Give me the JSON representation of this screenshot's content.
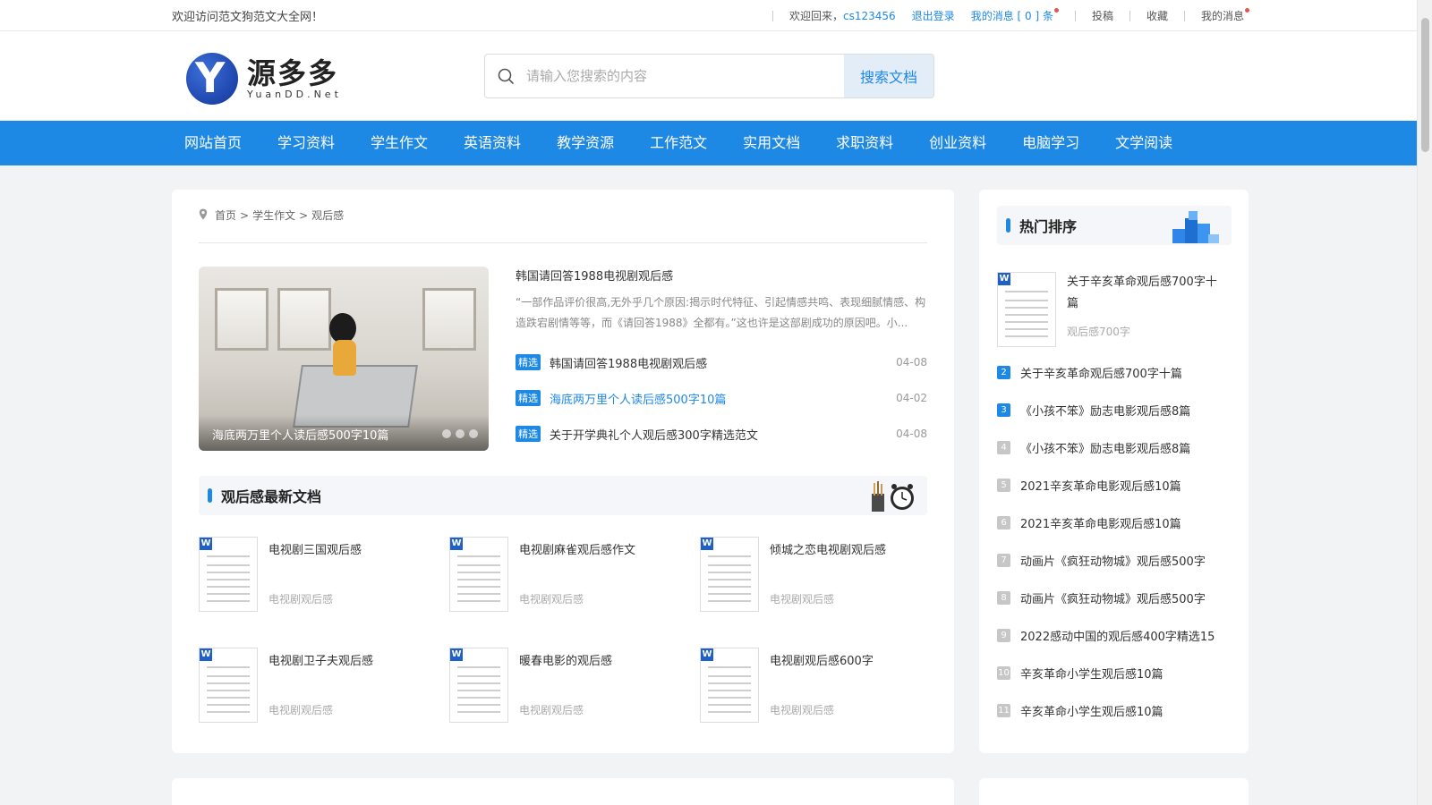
{
  "topbar": {
    "welcome_site": "欢迎访问范文狗范文大全网！",
    "welcome_back": "欢迎回来，",
    "username": "cs123456",
    "logout": "退出登录",
    "my_messages": "我的消息 [ 0 ] 条",
    "submit": "投稿",
    "favorites": "收藏",
    "my_messages_short": "我的消息"
  },
  "logo": {
    "cn": "源多多",
    "en": "YuanDD.Net"
  },
  "search": {
    "placeholder": "请输入您搜索的内容",
    "button": "搜索文档"
  },
  "nav": [
    "网站首页",
    "学习资料",
    "学生作文",
    "英语资料",
    "教学资源",
    "工作范文",
    "实用文档",
    "求职资料",
    "创业资料",
    "电脑学习",
    "文学阅读"
  ],
  "breadcrumb": {
    "home": "首页",
    "level1": "学生作文",
    "level2": "观后感",
    "sep": ">"
  },
  "banner": {
    "caption": "海底两万里个人读后感500字10篇"
  },
  "feature": {
    "title": "韩国请回答1988电视剧观后感",
    "desc": "“一部作品评价很高,无外乎几个原因:揭示时代特征、引起情感共鸣、表现细腻情感、构造跌宕剧情等等，而《请回答1988》全都有。”这也许是这部剧成功的原因吧。小...",
    "items": [
      {
        "tag": "精选",
        "title": "韩国请回答1988电视剧观后感",
        "date": "04-08"
      },
      {
        "tag": "精选",
        "title": "海底两万里个人读后感500字10篇",
        "date": "04-02"
      },
      {
        "tag": "精选",
        "title": "关于开学典礼个人观后感300字精选范文",
        "date": "04-08"
      }
    ]
  },
  "latest": {
    "title": "观后感最新文档",
    "docs": [
      {
        "title": "电视剧三国观后感",
        "sub": "电视剧观后感"
      },
      {
        "title": "电视剧麻雀观后感作文",
        "sub": "电视剧观后感"
      },
      {
        "title": "倾城之恋电视剧观后感",
        "sub": "电视剧观后感"
      },
      {
        "title": "电视剧卫子夫观后感",
        "sub": "电视剧观后感"
      },
      {
        "title": "暖春电影的观后感",
        "sub": "电视剧观后感"
      },
      {
        "title": "电视剧观后感600字",
        "sub": "电视剧观后感"
      }
    ]
  },
  "hot": {
    "title": "热门排序",
    "top": {
      "title": "关于辛亥革命观后感700字十篇",
      "sub": "观后感700字"
    },
    "list": [
      {
        "n": "2",
        "title": "关于辛亥革命观后感700字十篇"
      },
      {
        "n": "3",
        "title": "《小孩不笨》励志电影观后感8篇"
      },
      {
        "n": "4",
        "title": "《小孩不笨》励志电影观后感8篇"
      },
      {
        "n": "5",
        "title": "2021辛亥革命电影观后感10篇"
      },
      {
        "n": "6",
        "title": "2021辛亥革命电影观后感10篇"
      },
      {
        "n": "7",
        "title": "动画片《疯狂动物城》观后感500字"
      },
      {
        "n": "8",
        "title": "动画片《疯狂动物城》观后感500字"
      },
      {
        "n": "9",
        "title": "2022感动中国的观后感400字精选15"
      },
      {
        "n": "10",
        "title": "辛亥革命小学生观后感10篇"
      },
      {
        "n": "11",
        "title": "辛亥革命小学生观后感10篇"
      }
    ]
  },
  "colors": {
    "accent": "#1e88e5",
    "page_bg": "#f2f3f5",
    "nav_bg": "#1e88e5"
  }
}
